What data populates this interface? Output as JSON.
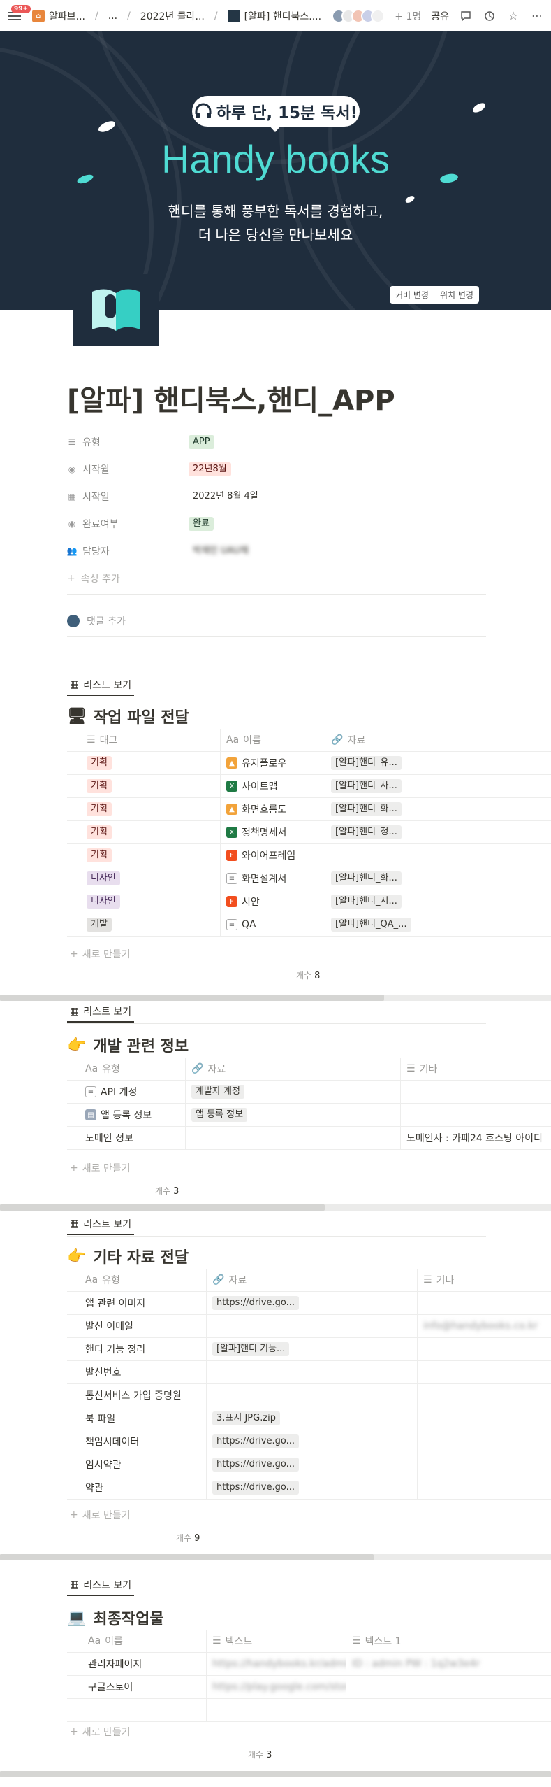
{
  "topbar": {
    "badge": "99+",
    "crumbs": [
      "알파브...",
      "...",
      "2022년 클라...",
      "[알파] 핸디북스...."
    ],
    "viewer_count": "+ 1명",
    "share": "공유"
  },
  "cover": {
    "bubble": "하루 단, 15분 독서!",
    "title": "Handy books",
    "sub1": "핸디를 통해 풍부한 독서를 경험하고,",
    "sub2": "더 나은 당신을 만나보세요",
    "btn_change": "커버 변경",
    "btn_position": "위치 변경"
  },
  "page": {
    "title": "[알파] 핸디북스,핸디_APP"
  },
  "props": [
    {
      "name": "유형",
      "icon": "list-icon",
      "value": "APP",
      "style": "green"
    },
    {
      "name": "시작월",
      "icon": "select-icon",
      "value": "22년8월",
      "style": "red"
    },
    {
      "name": "시작일",
      "icon": "calendar-icon",
      "value": "2022년 8월 4일",
      "style": "plain"
    },
    {
      "name": "완료여부",
      "icon": "select-icon",
      "value": "완료",
      "style": "green"
    },
    {
      "name": "담당자",
      "icon": "people-icon",
      "value": "박재민 UAU채",
      "style": "person"
    }
  ],
  "add_property": "속성 추가",
  "add_comment": "댓글 추가",
  "db1": {
    "view": "리스트 보기",
    "title": "작업 파일 전달",
    "cols": [
      "태그",
      "이름",
      "자료"
    ],
    "rows": [
      {
        "tag": "기획",
        "tagStyle": "red",
        "icon": "orange",
        "name": "유저플로우",
        "file": "[알파]핸디_유..."
      },
      {
        "tag": "기획",
        "tagStyle": "red",
        "icon": "green",
        "name": "사이트맵",
        "file": "[알파]핸디_사..."
      },
      {
        "tag": "기획",
        "tagStyle": "red",
        "icon": "orange",
        "name": "화면흐름도",
        "file": "[알파]핸디_화..."
      },
      {
        "tag": "기획",
        "tagStyle": "red",
        "icon": "green",
        "name": "정책명세서",
        "file": "[알파]핸디_정..."
      },
      {
        "tag": "기획",
        "tagStyle": "red",
        "icon": "figma",
        "name": "와이어프레임",
        "file": ""
      },
      {
        "tag": "디자인",
        "tagStyle": "purple",
        "icon": "doc",
        "name": "화면설계서",
        "file": "[알파]핸디_화..."
      },
      {
        "tag": "디자인",
        "tagStyle": "purple",
        "icon": "figma",
        "name": "시안",
        "file": "[알파]핸디_시..."
      },
      {
        "tag": "개발",
        "tagStyle": "gray",
        "icon": "doc",
        "name": "QA",
        "file": "[알파]핸디_QA_..."
      }
    ],
    "new": "새로 만들기",
    "count_label": "개수",
    "count": "8"
  },
  "db2": {
    "view": "리스트 보기",
    "title": "개발 관련 정보",
    "cols": [
      "유형",
      "자료",
      "기타"
    ],
    "rows": [
      {
        "name": "API 계정",
        "icon": "doc",
        "file": "계발자 계정",
        "etc": ""
      },
      {
        "name": "앱 등록 정보",
        "icon": "note",
        "file": "앱 등록 정보",
        "etc": ""
      },
      {
        "name": "도메인 정보",
        "icon": "",
        "file": "",
        "etc": "도메인사 : 카페24 호스팅 아이디"
      }
    ],
    "new": "새로 만들기",
    "count_label": "개수",
    "count": "3"
  },
  "db3": {
    "view": "리스트 보기",
    "title": "기타 자료 전달",
    "cols": [
      "유형",
      "자료",
      "기타"
    ],
    "rows": [
      {
        "name": "앱 관련 이미지",
        "file": "https://drive.go...",
        "etc": ""
      },
      {
        "name": "발신 이메일",
        "file": "",
        "etc": "info@handybooks.co.kr"
      },
      {
        "name": "핸디 기능 정리",
        "file": "[알파]핸디 기능...",
        "etc": ""
      },
      {
        "name": "발신번호",
        "file": "",
        "etc": ""
      },
      {
        "name": "통신서비스 가입 증명원",
        "file": "",
        "etc": ""
      },
      {
        "name": "북 파일",
        "file": "3.표지 JPG.zip",
        "etc": ""
      },
      {
        "name": "책임시데이터",
        "file": "https://drive.go...",
        "etc": ""
      },
      {
        "name": "임시약관",
        "file": "https://drive.go...",
        "etc": ""
      },
      {
        "name": "약관",
        "file": "https://drive.go...",
        "etc": ""
      }
    ],
    "new": "새로 만들기",
    "count_label": "개수",
    "count": "9"
  },
  "db4": {
    "view": "리스트 보기",
    "title": "최종작업물",
    "cols": [
      "이름",
      "텍스트",
      "텍스트 1"
    ],
    "rows": [
      {
        "name": "관리자페이지",
        "text": "https://handybooks.kr/admin",
        "text1": "ID : admin PW : 1q2w3e4r"
      },
      {
        "name": "구글스토어",
        "text": "https://play.google.com/store",
        "text1": ""
      },
      {
        "name": "",
        "text": "",
        "text1": ""
      }
    ],
    "new": "새로 만들기",
    "count_label": "개수",
    "count": "3"
  },
  "colors": {
    "cover_bg": "#1f2d3d",
    "accent": "#4fdbd3",
    "badge": "#eb5757"
  }
}
